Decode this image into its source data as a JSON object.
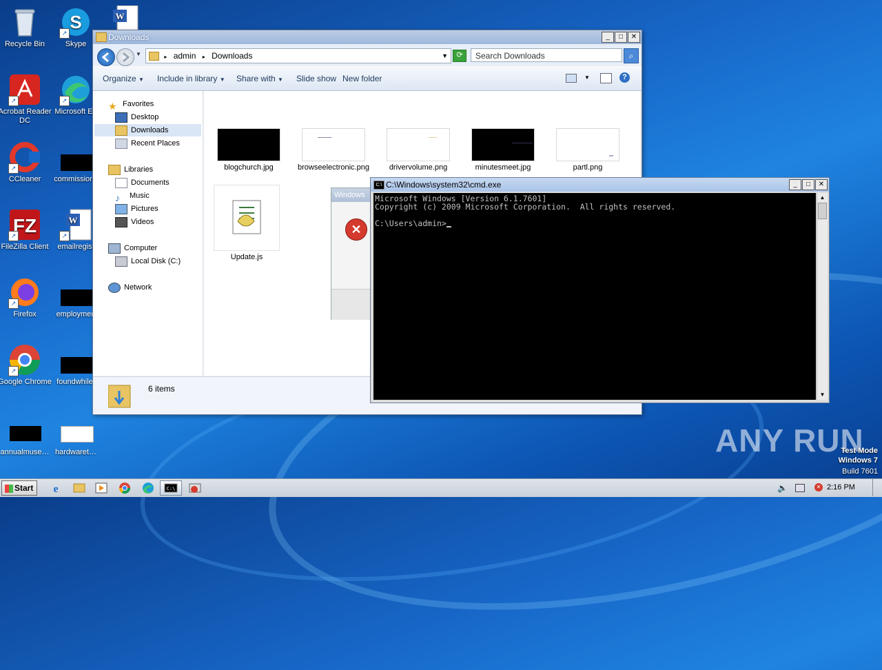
{
  "desktop": {
    "icons": [
      {
        "label": "Recycle Bin"
      },
      {
        "label": "Skype"
      },
      {
        "label": "Acrobat Reader DC"
      },
      {
        "label": "Microsoft Ed"
      },
      {
        "label": "CCleaner"
      },
      {
        "label": "commissionc"
      },
      {
        "label": "FileZilla Client"
      },
      {
        "label": "emailregist"
      },
      {
        "label": "Firefox"
      },
      {
        "label": "employmen"
      },
      {
        "label": "Google Chrome"
      },
      {
        "label": "foundwhile."
      },
      {
        "label": "annualmuse…"
      },
      {
        "label": "hardwaret…"
      }
    ]
  },
  "explorer": {
    "title": "Downloads",
    "breadcrumb": [
      "admin",
      "Downloads"
    ],
    "search_placeholder": "Search Downloads",
    "commands": [
      "Organize",
      "Include in library",
      "Share with",
      "Slide show",
      "New folder"
    ],
    "nav": {
      "favorites": "Favorites",
      "desktop": "Desktop",
      "downloads": "Downloads",
      "recent": "Recent Places",
      "libraries": "Libraries",
      "documents": "Documents",
      "music": "Music",
      "pictures": "Pictures",
      "videos": "Videos",
      "computer": "Computer",
      "localdisk": "Local Disk (C:)",
      "network": "Network"
    },
    "files": [
      {
        "name": "blogchurch.jpg"
      },
      {
        "name": "browseelectronic.png"
      },
      {
        "name": "drivervolume.png"
      },
      {
        "name": "minutesmeet.jpg"
      },
      {
        "name": "partl.png"
      },
      {
        "name": "Update.js"
      }
    ],
    "status": "6 items"
  },
  "error_dialog": {
    "title": "Windows"
  },
  "cmd": {
    "title": "C:\\Windows\\system32\\cmd.exe",
    "line1": "Microsoft Windows [Version 6.1.7601]",
    "line2": "Copyright (c) 2009 Microsoft Corporation.  All rights reserved.",
    "prompt": "C:\\Users\\admin>"
  },
  "taskbar": {
    "start": "Start",
    "time": "2:16 PM"
  },
  "watermark": {
    "brand": "ANY RUN",
    "mode_line1": "Test Mode",
    "mode_line2": "Windows 7",
    "mode_line3": "Build 7601"
  }
}
